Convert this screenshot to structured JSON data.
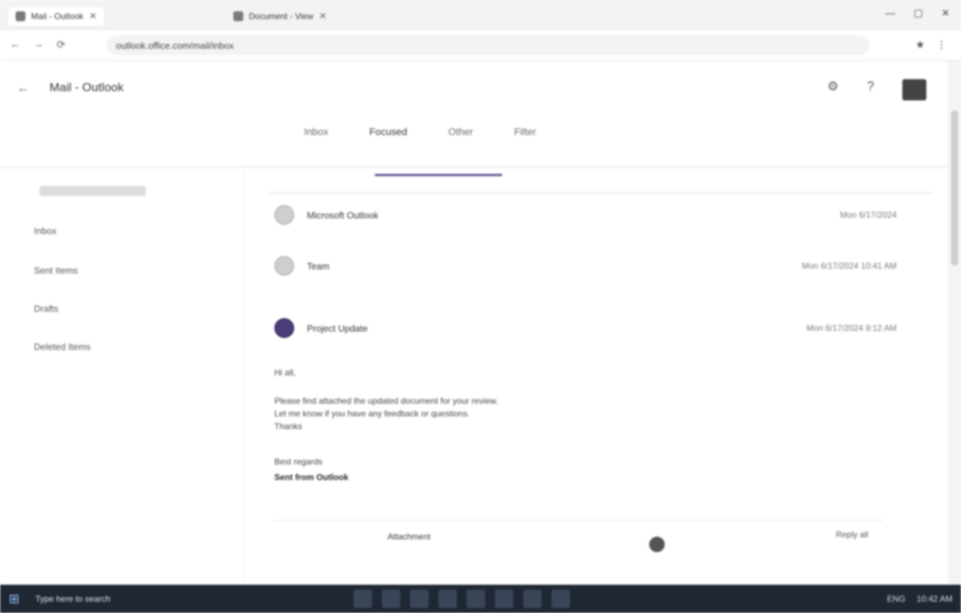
{
  "browser": {
    "tabs": [
      {
        "title": "Mail - Outlook"
      },
      {
        "title": "Document - View"
      }
    ],
    "window_controls": [
      "—",
      "▢",
      "✕"
    ],
    "nav": [
      "←",
      "→",
      "⟳"
    ],
    "address": "outlook.office.com/mail/inbox",
    "extension_icons": [
      "★",
      "⋮"
    ]
  },
  "app": {
    "back_icon": "←",
    "title": "Mail - Outlook",
    "header_icons": [
      "⚙",
      "?"
    ]
  },
  "page_tabs": [
    "Inbox",
    "Focused",
    "Other",
    "Filter"
  ],
  "sidebar": {
    "items": [
      "Inbox",
      "Sent Items",
      "Drafts",
      "Deleted Items"
    ]
  },
  "messages": [
    {
      "name": "Microsoft Outlook",
      "date": "Mon 6/17/2024"
    },
    {
      "name": "Team",
      "date": "Mon 6/17/2024 10:41 AM"
    },
    {
      "name": "Project Update",
      "date": "Mon 6/17/2024 9:12 AM"
    }
  ],
  "body": {
    "greeting": "Hi all,",
    "lines": [
      "Please find attached the updated document for your review.",
      "Let me know if you have any feedback or questions.",
      "Thanks"
    ],
    "signature": "Best regards",
    "footer_lines": [
      "Sent from Outlook"
    ]
  },
  "attachment": {
    "label": "Attachment",
    "address": "Reply all"
  },
  "taskbar": {
    "start_icon": "⊞",
    "label": "Type here to search",
    "tray": [
      "ENG",
      "10:42 AM"
    ]
  }
}
